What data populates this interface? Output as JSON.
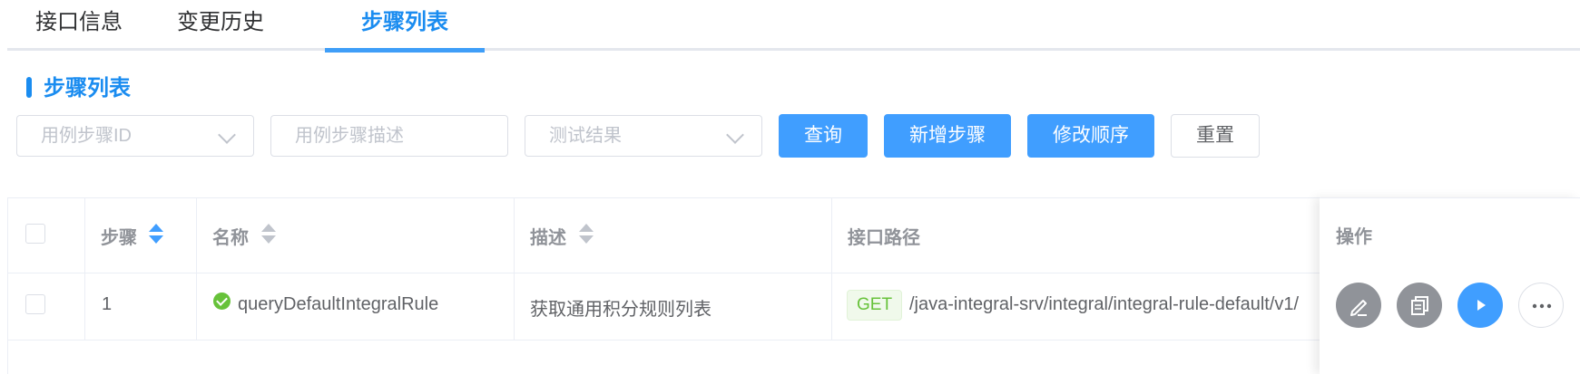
{
  "tabs": [
    {
      "label": "接口信息",
      "active": false
    },
    {
      "label": "变更历史",
      "active": false
    },
    {
      "label": "步骤列表",
      "active": true
    }
  ],
  "section": {
    "title": "步骤列表"
  },
  "filters": {
    "step_id_placeholder": "用例步骤ID",
    "step_desc_placeholder": "用例步骤描述",
    "result_placeholder": "测试结果"
  },
  "buttons": {
    "query": "查询",
    "add_step": "新增步骤",
    "reorder": "修改顺序",
    "reset": "重置"
  },
  "table": {
    "headers": {
      "step": "步骤",
      "name": "名称",
      "description": "描述",
      "path": "接口路径",
      "actions": "操作"
    },
    "rows": [
      {
        "step": "1",
        "status": "success",
        "name": "queryDefaultIntegralRule",
        "description": "获取通用积分规则列表",
        "method": "GET",
        "path": "/java-integral-srv/integral/integral-rule-default/v1/"
      }
    ]
  },
  "icons": {
    "sort": "sort-caret-icon",
    "status": "check-circle-icon",
    "edit": "edit-icon",
    "copy": "copy-icon",
    "run": "play-icon",
    "more": "more-icon"
  },
  "colors": {
    "accent": "#409eff",
    "tab_active": "#1a8cf0",
    "success": "#67c23a",
    "gray_button": "#909399"
  }
}
